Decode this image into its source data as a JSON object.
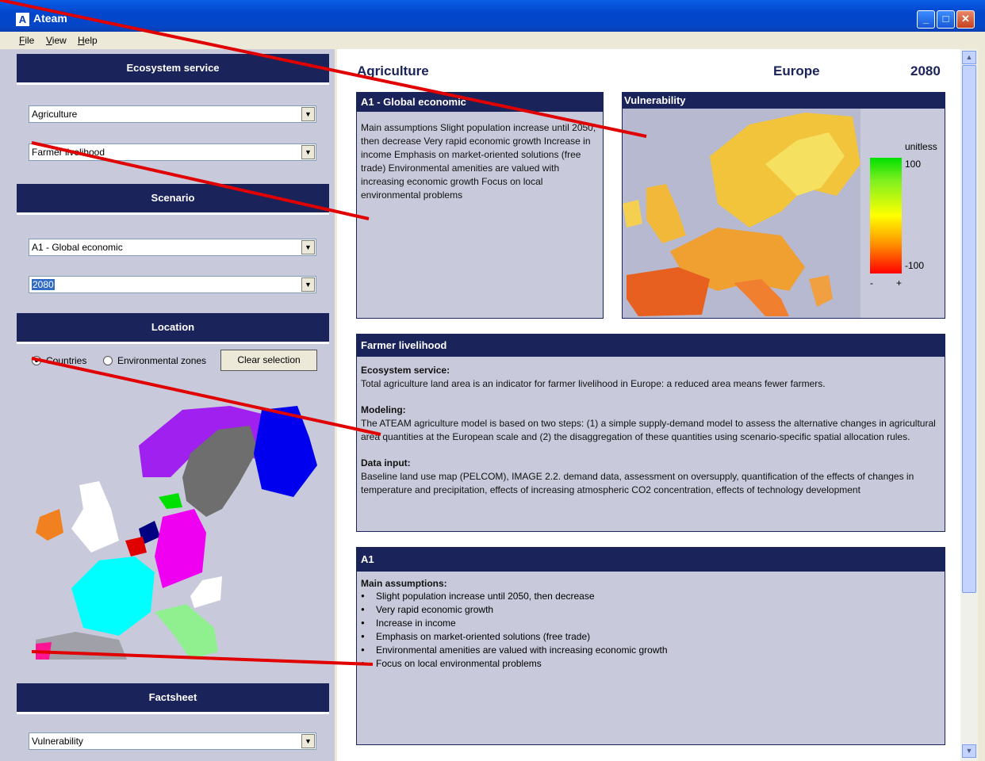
{
  "window": {
    "title": "Ateam",
    "icon": "A"
  },
  "menu": [
    "File",
    "View",
    "Help"
  ],
  "left": {
    "ecosystem_header": "Ecosystem service",
    "ecosystem_value": "Agriculture",
    "service_value": "Farmer livelihood",
    "scenario_header": "Scenario",
    "scenario_value": "A1 - Global economic",
    "year_value": "2080",
    "location_header": "Location",
    "radio_countries": "Countries",
    "radio_zones": "Environmental zones",
    "clear_button": "Clear selection",
    "factsheet_header": "Factsheet",
    "factsheet_value": "Vulnerability"
  },
  "main": {
    "title": "Agriculture",
    "region": "Europe",
    "year": "2080",
    "scenario_panel": {
      "title": "A1 - Global economic",
      "text": "Main assumptions Slight population increase until 2050, then decrease Very rapid economic growth Increase in income Emphasis on market-oriented solutions (free trade) Environmental amenities are valued with increasing economic growth Focus on local environmental problems"
    },
    "map_panel": {
      "title": "Vulnerability",
      "legend_unit": "unitless",
      "legend_max": "100",
      "legend_min": "-100",
      "legend_minus": "-",
      "legend_plus": "+"
    },
    "service_panel": {
      "title": "Farmer livelihood",
      "h1": "Ecosystem service:",
      "t1": "Total agriculture land area is an indicator for farmer livelihood in Europe: a reduced area means fewer farmers.",
      "h2": "Modeling:",
      "t2": "The ATEAM agriculture model is based on two steps: (1) a simple supply-demand model to assess the alternative changes in agricultural area quantities at the European scale and (2) the disaggregation of these quantities using scenario-specific spatial allocation rules.",
      "h3": "Data input:",
      "t3": "Baseline land use map (PELCOM), IMAGE 2.2. demand data, assessment on oversupply, quantification of the effects of changes in temperature and precipitation, effects of increasing atmospheric CO2 concentration, effects of technology development"
    },
    "a1_panel": {
      "title": "A1",
      "heading": "Main assumptions:",
      "items": [
        "Slight population increase until 2050, then decrease",
        "Very rapid economic growth",
        "Increase in income",
        "Emphasis on market-oriented solutions (free trade)",
        "Environmental amenities are valued with increasing economic growth",
        "Focus on local environmental problems"
      ]
    }
  },
  "colors": {
    "header": "#1B235B",
    "panel": "#C8CADB",
    "annotation": "#E00000"
  }
}
